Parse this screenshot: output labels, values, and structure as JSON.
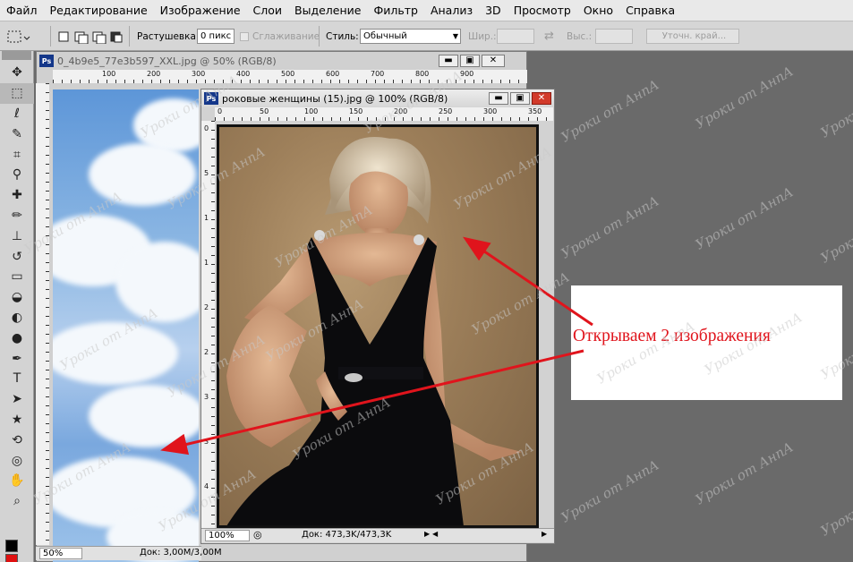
{
  "menu": [
    "Файл",
    "Редактирование",
    "Изображение",
    "Слои",
    "Выделение",
    "Фильтр",
    "Анализ",
    "3D",
    "Просмотр",
    "Окно",
    "Справка"
  ],
  "options": {
    "feather_label": "Растушевка:",
    "feather_value": "0 пикс",
    "antialias_label": "Сглаживание",
    "style_label": "Стиль:",
    "style_value": "Обычный",
    "width_label": "Шир.:",
    "height_label": "Выс.:",
    "refine_edge_label": "Уточн. край..."
  },
  "doc_back": {
    "title": "0_4b9e5_77e3b597_XXL.jpg @ 50% (RGB/8)",
    "zoom": "50%",
    "doc_info": "Док: 3,00M/3,00M",
    "ruler_labels": [
      "100",
      "200",
      "300",
      "400",
      "500",
      "600",
      "700",
      "800",
      "900"
    ]
  },
  "doc_front": {
    "title": "роковые женщины (15).jpg @ 100% (RGB/8)",
    "zoom": "100%",
    "doc_info": "Док: 473,3K/473,3K",
    "ruler_h": [
      "0",
      "50",
      "100",
      "150",
      "200",
      "250",
      "300",
      "350"
    ],
    "ruler_v": [
      "0",
      "5",
      "1",
      "1",
      "2",
      "2",
      "3",
      "3",
      "4",
      "4"
    ]
  },
  "annotation": {
    "text": "Открываем 2 изображения",
    "color": "#e0141c"
  },
  "watermark_text": "Уроки от АнnА",
  "colors": {
    "foreground": "#000000",
    "background": "#ff0000"
  },
  "tool_icons": [
    "move-icon",
    "marquee-icon",
    "lasso-icon",
    "quick-select-icon",
    "crop-icon",
    "eyedropper-icon",
    "healing-icon",
    "brush-icon",
    "stamp-icon",
    "history-brush-icon",
    "eraser-icon",
    "paint-bucket-icon",
    "dodge-icon",
    "burn-icon",
    "pen-icon",
    "type-icon",
    "path-select-icon",
    "shape-icon",
    "3d-rotate-icon",
    "3d-orbit-icon",
    "hand-icon",
    "zoom-icon"
  ]
}
